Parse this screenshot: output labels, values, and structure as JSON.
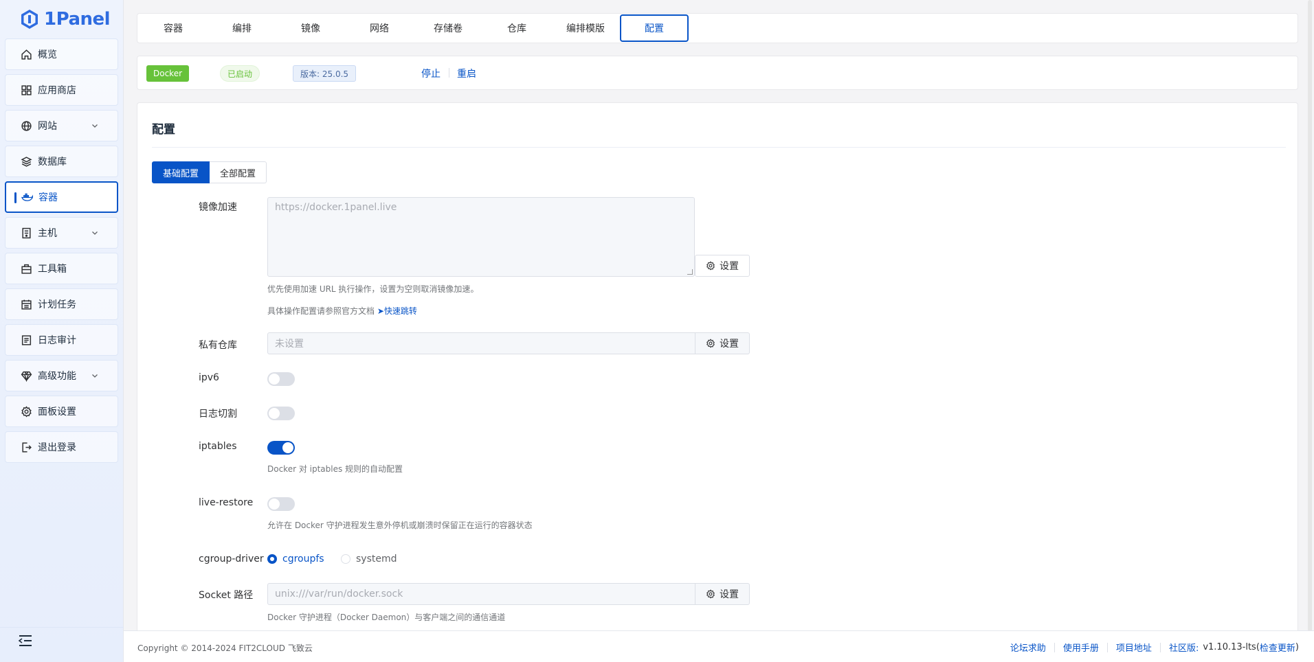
{
  "brand": {
    "name": "1Panel"
  },
  "sidebar": {
    "items": [
      {
        "label": "概览",
        "icon": "home-icon"
      },
      {
        "label": "应用商店",
        "icon": "grid-icon"
      },
      {
        "label": "网站",
        "icon": "globe-icon"
      },
      {
        "label": "数据库",
        "icon": "layers-icon"
      },
      {
        "label": "容器",
        "icon": "docker-icon",
        "active": true
      },
      {
        "label": "主机",
        "icon": "server-icon"
      },
      {
        "label": "工具箱",
        "icon": "toolbox-icon"
      },
      {
        "label": "计划任务",
        "icon": "calendar-icon"
      },
      {
        "label": "日志审计",
        "icon": "log-icon"
      },
      {
        "label": "高级功能",
        "icon": "diamond-icon"
      },
      {
        "label": "面板设置",
        "icon": "gear-icon"
      },
      {
        "label": "退出登录",
        "icon": "logout-icon"
      }
    ]
  },
  "tabs": [
    {
      "label": "容器"
    },
    {
      "label": "编排"
    },
    {
      "label": "镜像"
    },
    {
      "label": "网络"
    },
    {
      "label": "存储卷"
    },
    {
      "label": "仓库"
    },
    {
      "label": "编排模版"
    },
    {
      "label": "配置",
      "active": true
    }
  ],
  "status": {
    "docker": "Docker",
    "state": "已启动",
    "version": "版本: 25.0.5",
    "stop": "停止",
    "restart": "重启"
  },
  "card": {
    "title": "配置",
    "seg_basic": "基础配置",
    "seg_all": "全部配置"
  },
  "form": {
    "mirror_label": "镜像加速",
    "mirror_placeholder": "https://docker.1panel.live",
    "set_label": "设置",
    "mirror_hint1": "优先使用加速 URL 执行操作，设置为空则取消镜像加速。",
    "mirror_hint2": "具体操作配置请参照官方文档",
    "mirror_jump": "快速跳转",
    "registry_label": "私有仓库",
    "registry_value": "未设置",
    "ipv6_label": "ipv6",
    "ipv6_on": false,
    "logcut_label": "日志切割",
    "logcut_on": false,
    "iptables_label": "iptables",
    "iptables_on": true,
    "iptables_hint": "Docker 对 iptables 规则的自动配置",
    "live_restore_label": "live-restore",
    "live_restore_on": false,
    "live_restore_hint": "允许在 Docker 守护进程发生意外停机或崩溃时保留正在运行的容器状态",
    "cgroup_label": "cgroup-driver",
    "cgroup_opt1": "cgroupfs",
    "cgroup_opt2": "systemd",
    "cgroup_selected": "cgroupfs",
    "socket_label": "Socket 路径",
    "socket_value": "unix:///var/run/docker.sock",
    "socket_hint": "Docker 守护进程（Docker Daemon）与客户端之间的通信通道"
  },
  "footer": {
    "copyright": "Copyright © 2014-2024 FIT2CLOUD 飞致云",
    "forum": "论坛求助",
    "manual": "使用手册",
    "project": "项目地址",
    "edition": "社区版:",
    "version": "v1.10.13-lts",
    "paren_open": "(",
    "check_update": "检查更新",
    "paren_close": ")"
  },
  "colors": {
    "primary": "#0854c7",
    "success": "#67c23a"
  }
}
